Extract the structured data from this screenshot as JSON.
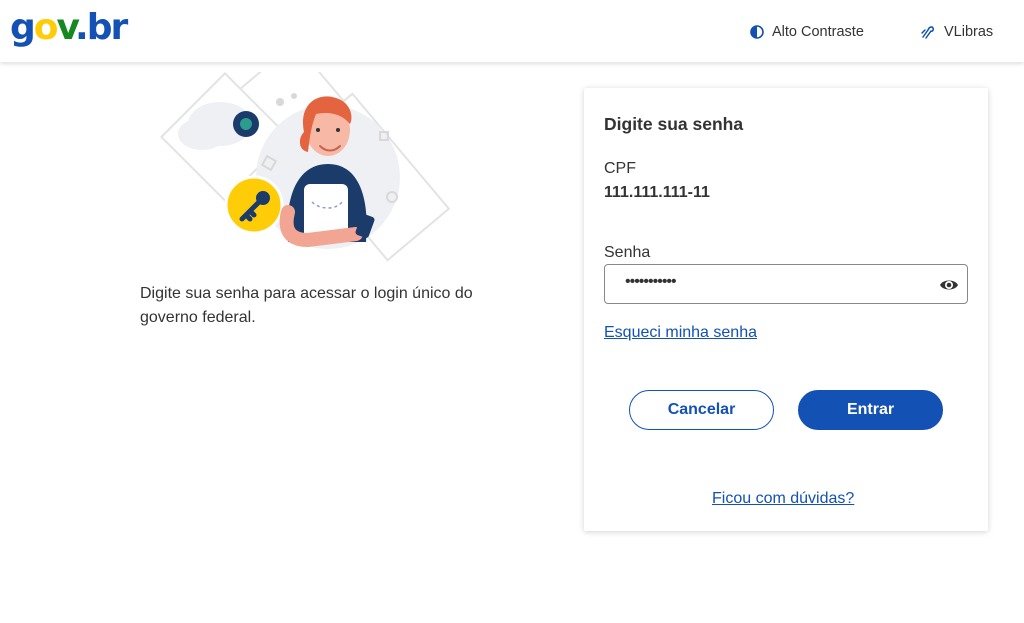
{
  "header": {
    "logo": {
      "g": "g",
      "o": "o",
      "v": "v",
      "dot": ".",
      "br": "br"
    },
    "contrast_label": "Alto Contraste",
    "vlibras_label": "VLibras"
  },
  "intro": {
    "text": "Digite sua senha para acessar o login único do governo federal."
  },
  "form": {
    "title": "Digite sua senha",
    "cpf_label": "CPF",
    "cpf_value": "111.111.111-11",
    "senha_label": "Senha",
    "senha_value": "•••••••••••",
    "forgot_link": "Esqueci minha senha",
    "cancel_button": "Cancelar",
    "submit_button": "Entrar",
    "help_link": "Ficou com dúvidas?"
  },
  "icons": {
    "contrast": "contrast-icon",
    "vlibras": "vlibras-hand-icon",
    "eye": "eye-icon"
  },
  "colors": {
    "primary": "#1351b4",
    "logo_yellow": "#ffcd07",
    "logo_green": "#168821",
    "text": "#333333"
  }
}
